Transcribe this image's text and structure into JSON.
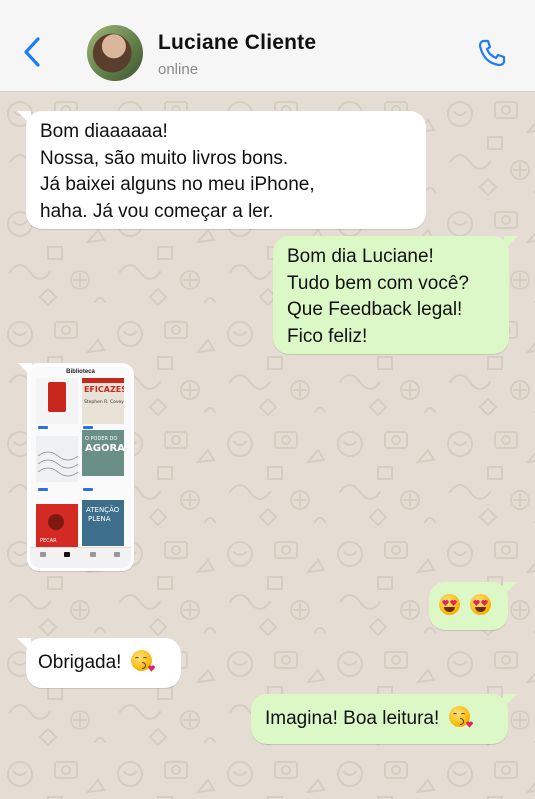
{
  "header": {
    "contact_name": "Luciane Cliente",
    "status": "online",
    "back_icon": "chevron-left-icon",
    "call_icon": "phone-icon",
    "accent_color": "#1f7cf2"
  },
  "messages": [
    {
      "direction": "incoming",
      "lines": [
        "Bom diaaaaaa!",
        "Nossa, são muito livros bons.",
        "Já baixei alguns no meu iPhone,",
        "haha. Já vou começar a ler."
      ]
    },
    {
      "direction": "outgoing",
      "lines": [
        "Bom dia Luciane!",
        "Tudo bem com você?",
        "Que Feedback legal!",
        "Fico feliz!"
      ]
    },
    {
      "direction": "incoming",
      "type": "image",
      "image": {
        "screen_title": "Biblioteca",
        "books": [
          "EFICAZES",
          "Stephen R. Covey",
          "O PODER DO",
          "AGORA",
          "ATENÇÃO",
          "PLENA",
          "PECAR"
        ]
      }
    },
    {
      "direction": "outgoing",
      "emoji": [
        "smiling-face-with-heart-eyes",
        "smiling-face-with-heart-eyes"
      ]
    },
    {
      "direction": "incoming",
      "text": "Obrigada!",
      "emoji": "face-blowing-a-kiss"
    },
    {
      "direction": "outgoing",
      "text": "Imagina! Boa leitura!",
      "emoji": "face-blowing-a-kiss"
    }
  ],
  "colors": {
    "incoming_bubble": "#ffffff",
    "outgoing_bubble": "#dcf8c6",
    "wallpaper": "#e5ddd3"
  }
}
